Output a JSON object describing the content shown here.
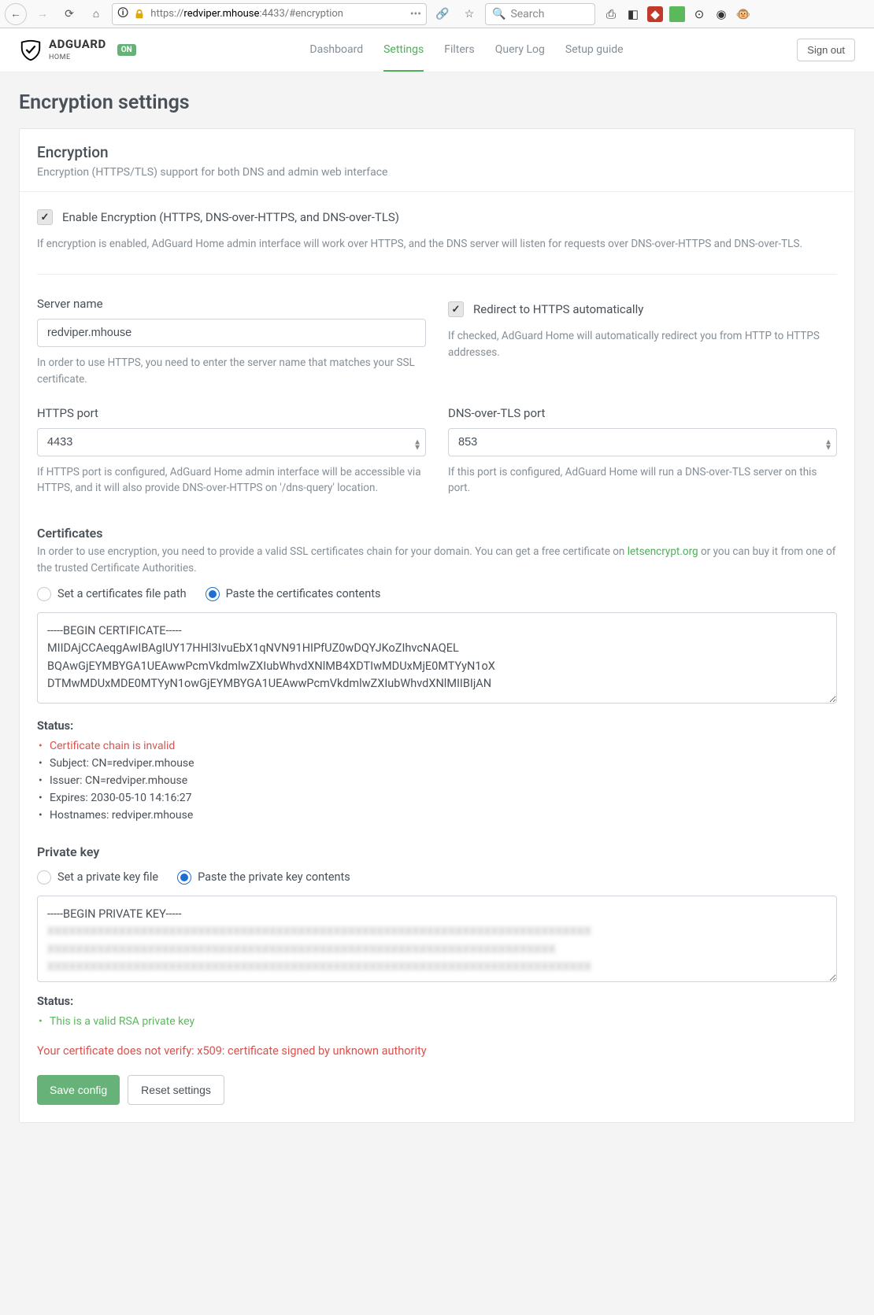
{
  "browser": {
    "url_prefix": "https://",
    "url_host": "redviper.mhouse",
    "url_port": ":4433",
    "url_path": "/#encryption",
    "search_placeholder": "Search"
  },
  "header": {
    "brand_top": "ADGUARD",
    "brand_bottom": "HOME",
    "on_badge": "ON",
    "nav": {
      "dashboard": "Dashboard",
      "settings": "Settings",
      "filters": "Filters",
      "querylog": "Query Log",
      "setupguide": "Setup guide"
    },
    "signout": "Sign out"
  },
  "page": {
    "title": "Encryption settings",
    "card_title": "Encryption",
    "card_subtitle": "Encryption (HTTPS/TLS) support for both DNS and admin web interface",
    "enable": {
      "label": "Enable Encryption (HTTPS, DNS-over-HTTPS, and DNS-over-TLS)",
      "help": "If encryption is enabled, AdGuard Home admin interface will work over HTTPS, and the DNS server will listen for requests over DNS-over-HTTPS and DNS-over-TLS."
    },
    "server": {
      "label": "Server name",
      "value": "redviper.mhouse",
      "help": "In order to use HTTPS, you need to enter the server name that matches your SSL certificate."
    },
    "redirect": {
      "label": "Redirect to HTTPS automatically",
      "help": "If checked, AdGuard Home will automatically redirect you from HTTP to HTTPS addresses."
    },
    "https_port": {
      "label": "HTTPS port",
      "value": "4433",
      "help": "If HTTPS port is configured, AdGuard Home admin interface will be accessible via HTTPS, and it will also provide DNS-over-HTTPS on '/dns-query' location."
    },
    "dot_port": {
      "label": "DNS-over-TLS port",
      "value": "853",
      "help": "If this port is configured, AdGuard Home will run a DNS-over-TLS server on this port."
    },
    "certs": {
      "title": "Certificates",
      "help_pre": "In order to use encryption, you need to provide a valid SSL certificates chain for your domain. You can get a free certificate on ",
      "help_link": "letsencrypt.org",
      "help_post": " or you can buy it from one of the trusted Certificate Authorities.",
      "radio_path": "Set a certificates file path",
      "radio_paste": "Paste the certificates contents",
      "textarea": "-----BEGIN CERTIFICATE-----\nMIIDAjCCAeqgAwIBAgIUY17HHl3IvuEbX1qNVN91HIPfUZ0wDQYJKoZIhvcNAQEL\nBQAwGjEYMBYGA1UEAwwPcmVkdmlwZXIubWhvdXNlMB4XDTIwMDUxMjE0MTYyN1oX\nDTMwMDUxMDE0MTYyN1owGjEYMBYGA1UEAwwPcmVkdmlwZXIubWhvdXNlMIIBIjAN",
      "status_label": "Status:",
      "status": {
        "invalid": "Certificate chain is invalid",
        "subject": "Subject: CN=redviper.mhouse",
        "issuer": "Issuer: CN=redviper.mhouse",
        "expires": "Expires: 2030-05-10 14:16:27",
        "hostnames": "Hostnames: redviper.mhouse"
      }
    },
    "pkey": {
      "title": "Private key",
      "radio_path": "Set a private key file",
      "radio_paste": "Paste the private key contents",
      "textarea_head": "-----BEGIN PRIVATE KEY-----",
      "status_label": "Status:",
      "status_ok": "This is a valid RSA private key"
    },
    "error": "Your certificate does not verify: x509: certificate signed by unknown authority",
    "save_btn": "Save config",
    "reset_btn": "Reset settings"
  }
}
